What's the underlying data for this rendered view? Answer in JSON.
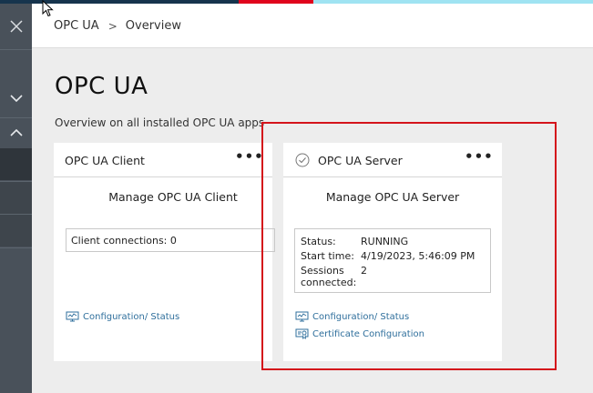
{
  "colors": {
    "topbar": [
      "#16344d",
      "#16344d",
      "#e0041c",
      "#9fe3f2"
    ],
    "sidebar": "#49515a",
    "highlight": "#d4141b",
    "link": "#2f6f9c"
  },
  "breadcrumb": {
    "root": "OPC UA",
    "separator": ">",
    "current": "Overview"
  },
  "page": {
    "title": "OPC UA",
    "subtitle": "Overview on all installed OPC UA apps"
  },
  "client_card": {
    "title": "OPC UA Client",
    "menu": "•••",
    "manage": "Manage OPC UA Client",
    "connections": "Client connections: 0",
    "link_config": "Configuration/ Status"
  },
  "server_card": {
    "status_icon": "check-circle-icon",
    "title": "OPC UA Server",
    "menu": "•••",
    "manage": "Manage OPC UA Server",
    "status_label": "Status:",
    "status_value": "RUNNING",
    "start_label": "Start time:",
    "start_value": "4/19/2023, 5:46:09 PM",
    "sessions_label_1": "Sessions",
    "sessions_label_2": "connected:",
    "sessions_value": "2",
    "link_config": "Configuration/ Status",
    "link_cert": "Certificate Configuration"
  }
}
